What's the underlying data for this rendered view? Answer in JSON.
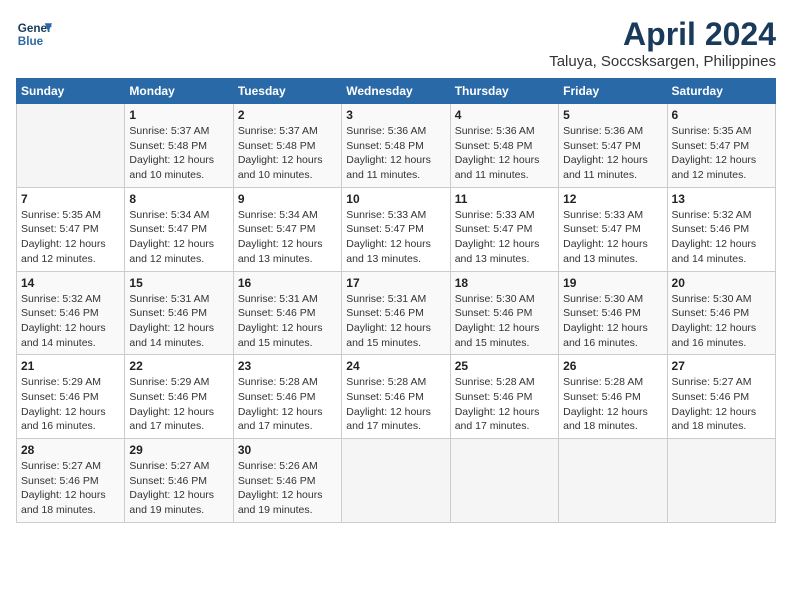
{
  "logo": {
    "line1": "General",
    "line2": "Blue"
  },
  "title": "April 2024",
  "subtitle": "Taluya, Soccsksargen, Philippines",
  "days_of_week": [
    "Sunday",
    "Monday",
    "Tuesday",
    "Wednesday",
    "Thursday",
    "Friday",
    "Saturday"
  ],
  "weeks": [
    [
      {
        "num": "",
        "info": ""
      },
      {
        "num": "1",
        "info": "Sunrise: 5:37 AM\nSunset: 5:48 PM\nDaylight: 12 hours\nand 10 minutes."
      },
      {
        "num": "2",
        "info": "Sunrise: 5:37 AM\nSunset: 5:48 PM\nDaylight: 12 hours\nand 10 minutes."
      },
      {
        "num": "3",
        "info": "Sunrise: 5:36 AM\nSunset: 5:48 PM\nDaylight: 12 hours\nand 11 minutes."
      },
      {
        "num": "4",
        "info": "Sunrise: 5:36 AM\nSunset: 5:48 PM\nDaylight: 12 hours\nand 11 minutes."
      },
      {
        "num": "5",
        "info": "Sunrise: 5:36 AM\nSunset: 5:47 PM\nDaylight: 12 hours\nand 11 minutes."
      },
      {
        "num": "6",
        "info": "Sunrise: 5:35 AM\nSunset: 5:47 PM\nDaylight: 12 hours\nand 12 minutes."
      }
    ],
    [
      {
        "num": "7",
        "info": "Sunrise: 5:35 AM\nSunset: 5:47 PM\nDaylight: 12 hours\nand 12 minutes."
      },
      {
        "num": "8",
        "info": "Sunrise: 5:34 AM\nSunset: 5:47 PM\nDaylight: 12 hours\nand 12 minutes."
      },
      {
        "num": "9",
        "info": "Sunrise: 5:34 AM\nSunset: 5:47 PM\nDaylight: 12 hours\nand 13 minutes."
      },
      {
        "num": "10",
        "info": "Sunrise: 5:33 AM\nSunset: 5:47 PM\nDaylight: 12 hours\nand 13 minutes."
      },
      {
        "num": "11",
        "info": "Sunrise: 5:33 AM\nSunset: 5:47 PM\nDaylight: 12 hours\nand 13 minutes."
      },
      {
        "num": "12",
        "info": "Sunrise: 5:33 AM\nSunset: 5:47 PM\nDaylight: 12 hours\nand 13 minutes."
      },
      {
        "num": "13",
        "info": "Sunrise: 5:32 AM\nSunset: 5:46 PM\nDaylight: 12 hours\nand 14 minutes."
      }
    ],
    [
      {
        "num": "14",
        "info": "Sunrise: 5:32 AM\nSunset: 5:46 PM\nDaylight: 12 hours\nand 14 minutes."
      },
      {
        "num": "15",
        "info": "Sunrise: 5:31 AM\nSunset: 5:46 PM\nDaylight: 12 hours\nand 14 minutes."
      },
      {
        "num": "16",
        "info": "Sunrise: 5:31 AM\nSunset: 5:46 PM\nDaylight: 12 hours\nand 15 minutes."
      },
      {
        "num": "17",
        "info": "Sunrise: 5:31 AM\nSunset: 5:46 PM\nDaylight: 12 hours\nand 15 minutes."
      },
      {
        "num": "18",
        "info": "Sunrise: 5:30 AM\nSunset: 5:46 PM\nDaylight: 12 hours\nand 15 minutes."
      },
      {
        "num": "19",
        "info": "Sunrise: 5:30 AM\nSunset: 5:46 PM\nDaylight: 12 hours\nand 16 minutes."
      },
      {
        "num": "20",
        "info": "Sunrise: 5:30 AM\nSunset: 5:46 PM\nDaylight: 12 hours\nand 16 minutes."
      }
    ],
    [
      {
        "num": "21",
        "info": "Sunrise: 5:29 AM\nSunset: 5:46 PM\nDaylight: 12 hours\nand 16 minutes."
      },
      {
        "num": "22",
        "info": "Sunrise: 5:29 AM\nSunset: 5:46 PM\nDaylight: 12 hours\nand 17 minutes."
      },
      {
        "num": "23",
        "info": "Sunrise: 5:28 AM\nSunset: 5:46 PM\nDaylight: 12 hours\nand 17 minutes."
      },
      {
        "num": "24",
        "info": "Sunrise: 5:28 AM\nSunset: 5:46 PM\nDaylight: 12 hours\nand 17 minutes."
      },
      {
        "num": "25",
        "info": "Sunrise: 5:28 AM\nSunset: 5:46 PM\nDaylight: 12 hours\nand 17 minutes."
      },
      {
        "num": "26",
        "info": "Sunrise: 5:28 AM\nSunset: 5:46 PM\nDaylight: 12 hours\nand 18 minutes."
      },
      {
        "num": "27",
        "info": "Sunrise: 5:27 AM\nSunset: 5:46 PM\nDaylight: 12 hours\nand 18 minutes."
      }
    ],
    [
      {
        "num": "28",
        "info": "Sunrise: 5:27 AM\nSunset: 5:46 PM\nDaylight: 12 hours\nand 18 minutes."
      },
      {
        "num": "29",
        "info": "Sunrise: 5:27 AM\nSunset: 5:46 PM\nDaylight: 12 hours\nand 19 minutes."
      },
      {
        "num": "30",
        "info": "Sunrise: 5:26 AM\nSunset: 5:46 PM\nDaylight: 12 hours\nand 19 minutes."
      },
      {
        "num": "",
        "info": ""
      },
      {
        "num": "",
        "info": ""
      },
      {
        "num": "",
        "info": ""
      },
      {
        "num": "",
        "info": ""
      }
    ]
  ]
}
